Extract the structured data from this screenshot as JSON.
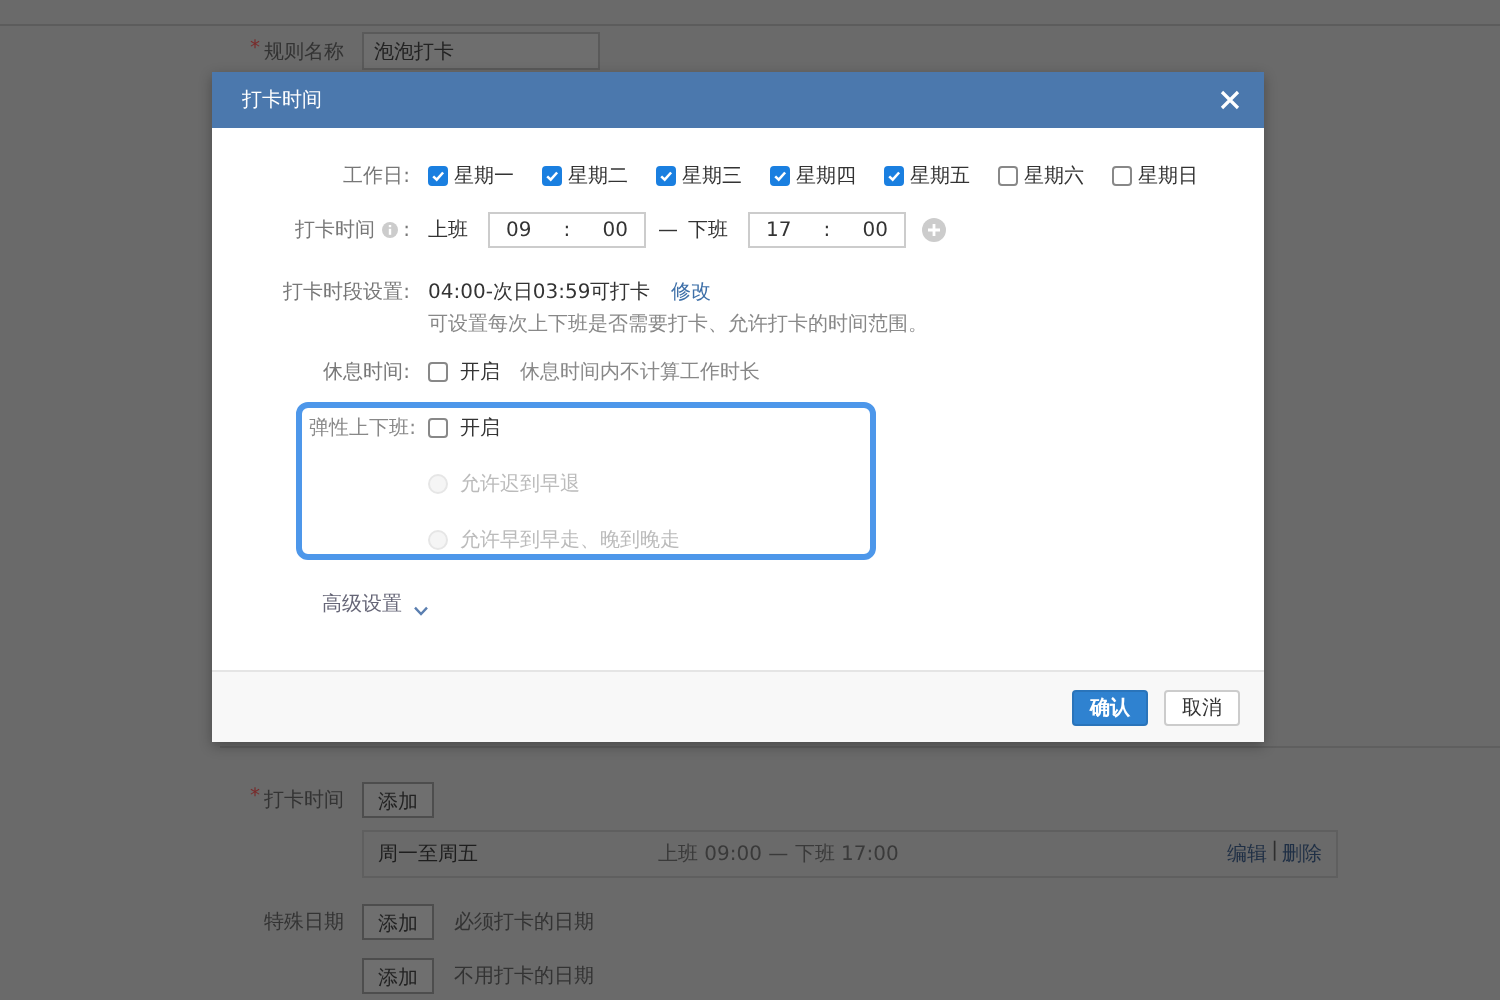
{
  "background_form": {
    "rule_name": {
      "required_mark": "*",
      "label": "规则名称",
      "value": "泡泡打卡"
    },
    "checkin_time": {
      "required_mark": "*",
      "label": "打卡时间",
      "add_button": "添加",
      "entries": [
        {
          "days": "周一至周五",
          "hours": "上班 09:00 — 下班 17:00",
          "edit": "编辑",
          "separator": "|",
          "delete": "删除"
        }
      ]
    },
    "special_dates": {
      "label": "特殊日期",
      "rows": [
        {
          "add_button": "添加",
          "hint": "必须打卡的日期"
        },
        {
          "add_button": "添加",
          "hint": "不用打卡的日期"
        }
      ]
    }
  },
  "dialog": {
    "title": "打卡时间",
    "workdays": {
      "label": "工作日:",
      "days": [
        {
          "label": "星期一",
          "checked": true
        },
        {
          "label": "星期二",
          "checked": true
        },
        {
          "label": "星期三",
          "checked": true
        },
        {
          "label": "星期四",
          "checked": true
        },
        {
          "label": "星期五",
          "checked": true
        },
        {
          "label": "星期六",
          "checked": false
        },
        {
          "label": "星期日",
          "checked": false
        }
      ]
    },
    "checkin_time": {
      "label": "打卡时间",
      "colon": ":",
      "on_label": "上班",
      "on_hour": "09",
      "time_colon": ":",
      "on_minute": "00",
      "dash": "—",
      "off_label": "下班",
      "off_hour": "17",
      "off_minute": "00"
    },
    "period": {
      "label": "打卡时段设置:",
      "value": "04:00-次日03:59可打卡",
      "link": "修改",
      "hint": "可设置每次上下班是否需要打卡、允许打卡的时间范围。"
    },
    "rest": {
      "label": "休息时间:",
      "checked": false,
      "option": "开启",
      "hint": "休息时间内不计算工作时长"
    },
    "flexible": {
      "label": "弹性上下班:",
      "highlighted": true,
      "checked": false,
      "option": "开启",
      "modes": [
        {
          "label": "允许迟到早退",
          "selected": false,
          "disabled": true
        },
        {
          "label": "允许早到早走、晚到晚走",
          "selected": false,
          "disabled": true
        }
      ]
    },
    "advanced": {
      "label": "高级设置",
      "expanded": false
    },
    "buttons": [
      {
        "label": "确认",
        "kind": "primary"
      },
      {
        "label": "取消",
        "kind": "default"
      }
    ]
  }
}
